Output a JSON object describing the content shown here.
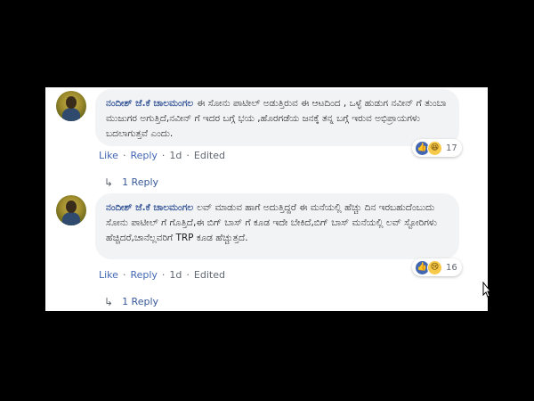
{
  "comments": [
    {
      "author": "ನಂದೀಶ್ ಜೆ.ಕೆ ಚಾಲಮಂಗಲ",
      "text": "ಈ ಸೋನು ಪಾಟೀಲ್ ಅಡುತ್ತಿರುವ ಈ ಆಟದಿಂದ , ಒಳ್ಳೆ ಹುಡುಗ ನವೀನ್ ಗೆ ತುಂಬಾ ಮುಜುಗರ ಅಗುತ್ತಿದೆ,ನವೀನ್ ಗೆ ಇದರ ಬಗ್ಗೆ ಭಯ ,ಹೊರಗಡೆಯ ಜನಕ್ಕೆ ತನ್ನ ಬಗ್ಗೆ ಇರುವ ಅಭಿಪ್ರಾಯಗಳು ಬದಲಾಗುತ್ತವೆ ಎಂದು.",
      "reaction_count": "17",
      "reaction_icons": [
        "like-icon",
        "haha-icon"
      ],
      "like": "Like",
      "reply": "Reply",
      "time": "1d",
      "edited": "Edited",
      "replies": "1 Reply"
    },
    {
      "author": "ನಂದೀಶ್ ಜೆ.ಕೆ ಚಾಲಮಂಗಲ",
      "text": "ಲವ್ ಮಾಡುವ ಹಾಗೆ ಅದುತ್ತಿದ್ದರೆ ಈ ಮನೆಯಲ್ಲಿ ಹೆಚ್ಚು ದಿನ ಇರಬಹುದೆಂಬುದು ಸೋನು ಪಾಟೀಲ್ ಗೆ ಗೊತ್ತಿದೆ,ಈ ಬಿಗ್ ಬಾಸ್ ಗೆ ಕೂಡ ಇದೇ ಬೇಕಿದೆ,ಬಿಗ್ ಬಾಸ್ ಮನೆಯಲ್ಲಿ ಲವ್ ಸ್ಟೋರಿಗಳು ಹೆಚ್ಚಿದರೆ,ಚಾನೆಲ್ಲವರಿಗೆ TRP ಕೂಡ ಹೆಚ್ಚುತ್ತದೆ.",
      "reaction_count": "16",
      "reaction_icons": [
        "like-icon",
        "sad-icon"
      ],
      "like": "Like",
      "reply": "Reply",
      "time": "1d",
      "edited": "Edited",
      "replies": "1 Reply"
    }
  ],
  "colors": {
    "link": "#4267b2",
    "author": "#385898",
    "bubble": "#f2f3f5",
    "meta": "#606770"
  }
}
